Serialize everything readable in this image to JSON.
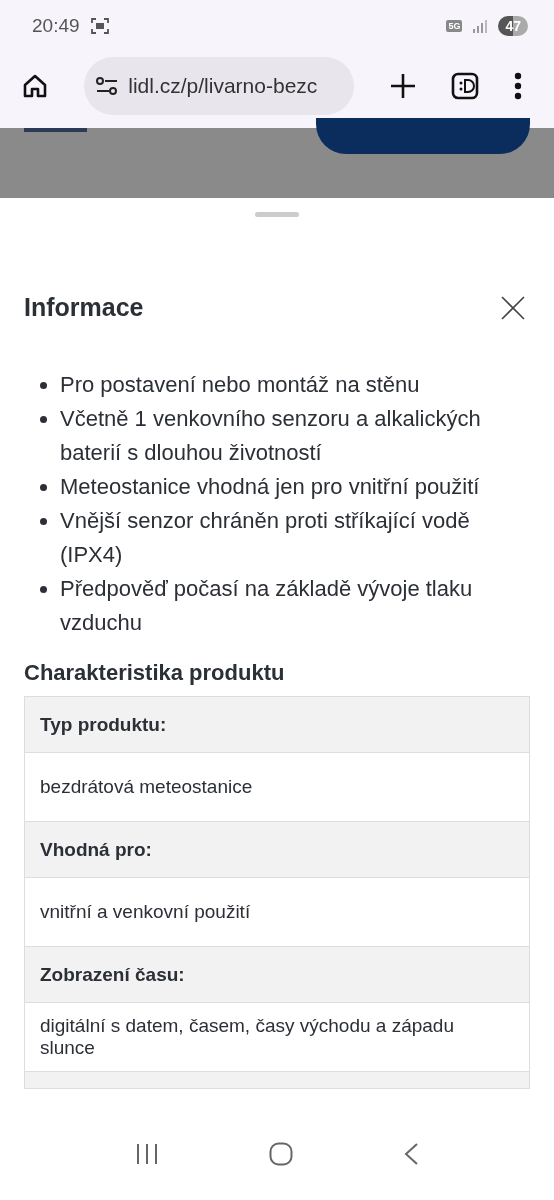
{
  "status_bar": {
    "time": "20:49",
    "network": "5G",
    "battery": "47"
  },
  "browser": {
    "url": "lidl.cz/p/livarno-bezc"
  },
  "sheet": {
    "title": "Informace",
    "bullets": [
      "Pro postavení nebo montáž na stěnu",
      "Včetně 1 venkovního senzoru a alkalických baterií s dlouhou životností",
      "Meteostanice vhodná jen pro vnitřní použití",
      "Vnější senzor chráněn proti stříkající vodě (IPX4)",
      "Předpověď počasí na základě vývoje tlaku vzduchu"
    ],
    "section_title": "Charakteristika produktu",
    "table": [
      {
        "label": "Typ produktu:",
        "value": "bezdrátová meteostanice"
      },
      {
        "label": "Vhodná pro:",
        "value": "vnitřní a venkovní použití"
      },
      {
        "label": "Zobrazení času:",
        "value": "digitální s datem, časem, časy východu a západu slunce"
      }
    ]
  }
}
